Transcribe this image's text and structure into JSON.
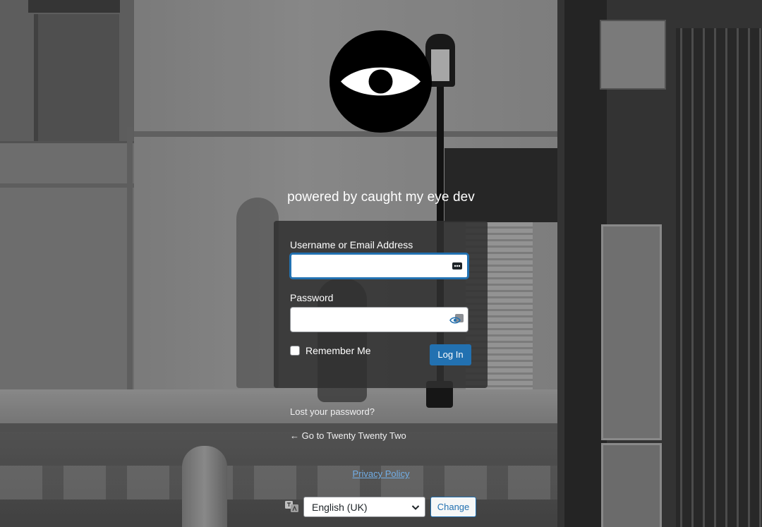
{
  "branding": {
    "tagline": "powered by caught my eye dev",
    "logo_icon": "eye-logo-icon"
  },
  "login_form": {
    "username_label": "Username or Email Address",
    "username_value": "",
    "password_label": "Password",
    "password_value": "",
    "remember_label": "Remember Me",
    "remember_checked": false,
    "submit_label": "Log In",
    "username_field_icon": "password-manager-icon",
    "password_field_icon": "show-password-eye-icon"
  },
  "links": {
    "lost_password": "Lost your password?",
    "back_to_site": "← Go to Twenty Twenty Two",
    "privacy_policy": "Privacy Policy"
  },
  "language": {
    "selected": "English (UK)",
    "change_label": "Change",
    "icon": "translate-icon"
  },
  "colors": {
    "accent": "#2271b1",
    "link": "#72aee6",
    "panel": "#303030"
  }
}
